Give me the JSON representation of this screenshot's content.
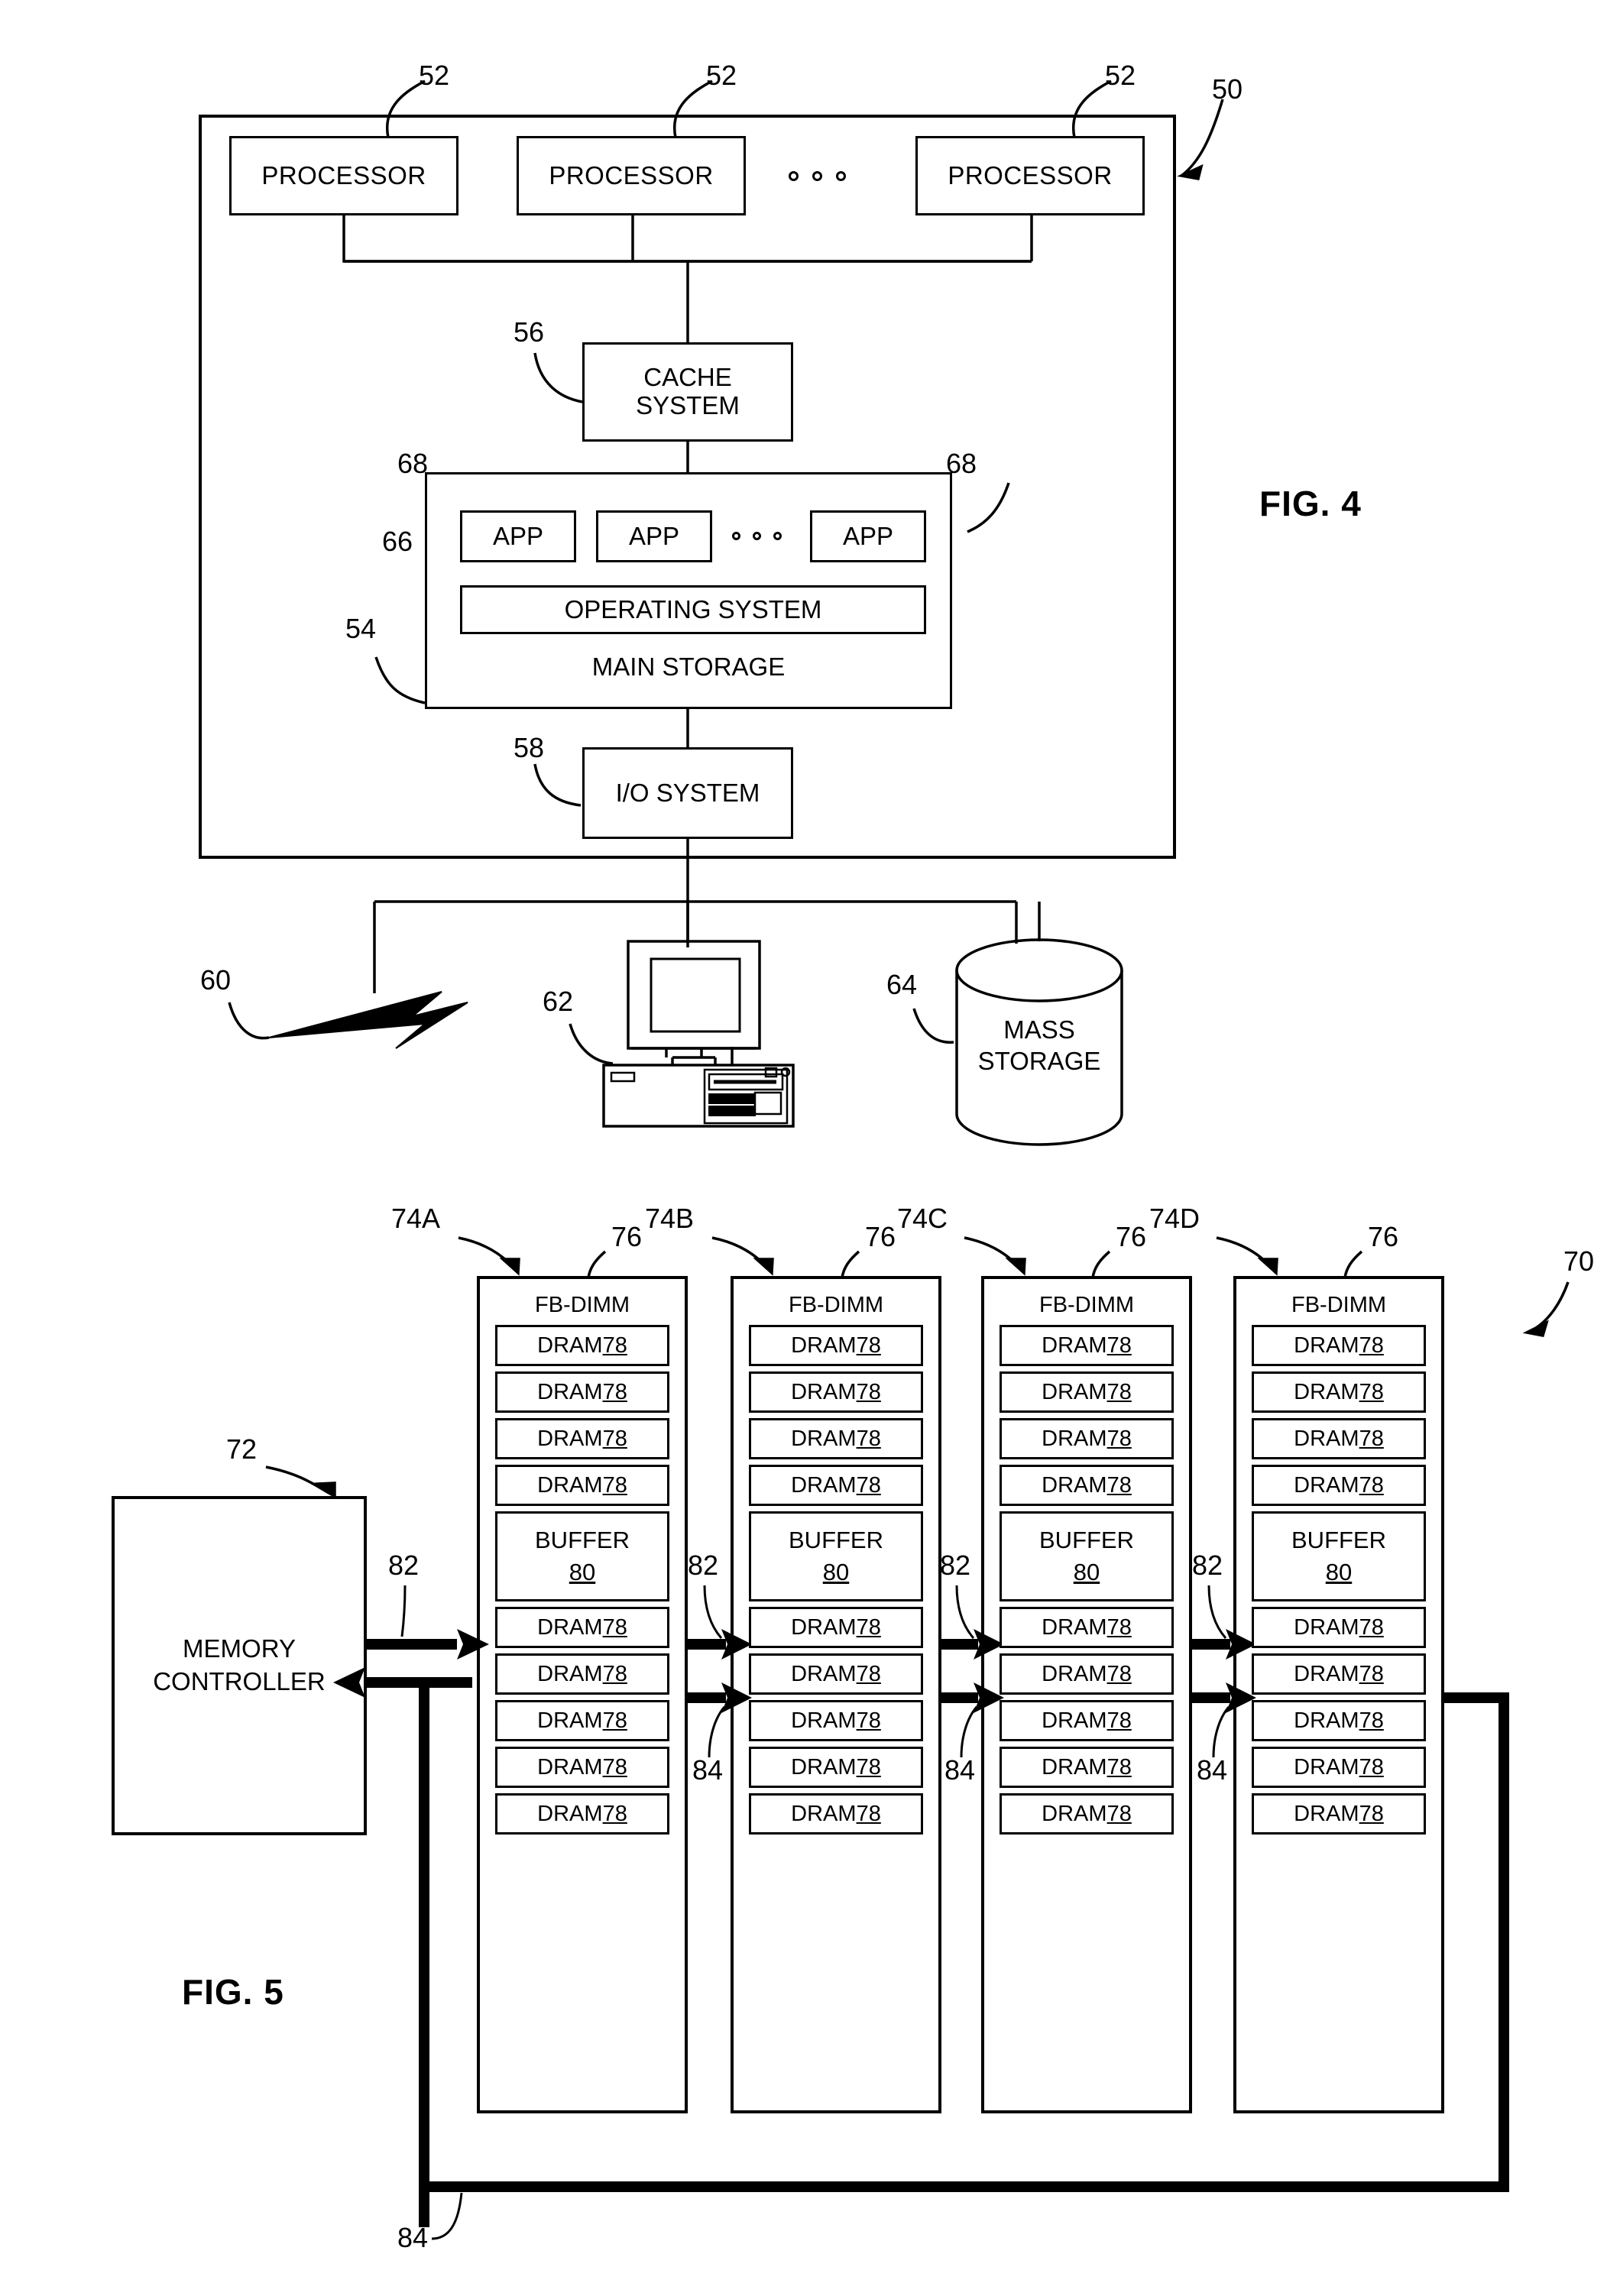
{
  "figures": [
    {
      "id": "fig4",
      "caption": "FIG. 4",
      "system_ref": "50",
      "processors": [
        {
          "label": "PROCESSOR",
          "ref": "52"
        },
        {
          "label": "PROCESSOR",
          "ref": "52"
        },
        {
          "label": "PROCESSOR",
          "ref": "52"
        }
      ],
      "processor_ellipsis": "o o o",
      "cache": {
        "line1": "CACHE",
        "line2": "SYSTEM",
        "ref": "56"
      },
      "main_storage": {
        "label": "MAIN STORAGE",
        "ref": "54",
        "apps": [
          {
            "label": "APP",
            "ref": "68"
          },
          {
            "label": "APP",
            "ref": ""
          },
          {
            "label": "APP",
            "ref": "68"
          }
        ],
        "app_ellipsis": "o o o",
        "operating_system": {
          "label": "OPERATING SYSTEM",
          "ref": "66"
        }
      },
      "io_system": {
        "label": "I/O SYSTEM",
        "ref": "58"
      },
      "network": {
        "ref": "60",
        "icon": "lightning-bolt-icon"
      },
      "workstation": {
        "ref": "62",
        "icon": "desktop-computer-icon"
      },
      "mass_storage": {
        "line1": "MASS",
        "line2": "STORAGE",
        "ref": "64",
        "icon": "cylinder-icon"
      }
    },
    {
      "id": "fig5",
      "caption": "FIG. 5",
      "system_ref": "70",
      "memory_controller": {
        "line1": "MEMORY",
        "line2": "CONTROLLER",
        "ref": "72"
      },
      "dimm_ref_label": "76",
      "dimm_title": "FB-DIMM",
      "dram_label": "DRAM",
      "dram_ref": "78",
      "buffer_label": "BUFFER",
      "buffer_ref": "80",
      "southbound_ref": "82",
      "northbound_ref": "84",
      "return_path_ref": "84",
      "dimms": [
        {
          "ref": "74A",
          "dram_above": 4,
          "dram_below": 5
        },
        {
          "ref": "74B",
          "dram_above": 4,
          "dram_below": 5
        },
        {
          "ref": "74C",
          "dram_above": 4,
          "dram_below": 5
        },
        {
          "ref": "74D",
          "dram_above": 4,
          "dram_below": 5
        }
      ],
      "link_refs_top": [
        "82",
        "82",
        "82",
        "82"
      ],
      "link_refs_bottom": [
        "84",
        "84",
        "84"
      ]
    }
  ]
}
